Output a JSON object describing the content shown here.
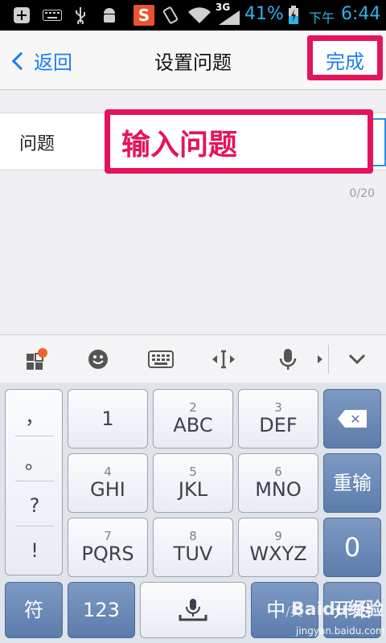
{
  "status_bar": {
    "network": "3G",
    "battery_percent": "41%",
    "time_period": "下午",
    "time": "6:44"
  },
  "nav": {
    "back_label": "返回",
    "title": "设置问题",
    "done_label": "完成"
  },
  "form": {
    "question_label": "问题",
    "input_value": "",
    "overlay_text": "输入问题",
    "counter": "0/20"
  },
  "keyboard": {
    "punctuation": [
      "，",
      "。",
      "?",
      "!"
    ],
    "rows": [
      [
        {
          "num": "",
          "label": "1"
        },
        {
          "num": "2",
          "label": "ABC"
        },
        {
          "num": "3",
          "label": "DEF"
        }
      ],
      [
        {
          "num": "4",
          "label": "GHI"
        },
        {
          "num": "5",
          "label": "JKL"
        },
        {
          "num": "6",
          "label": "MNO"
        }
      ],
      [
        {
          "num": "7",
          "label": "PQRS"
        },
        {
          "num": "8",
          "label": "TUV"
        },
        {
          "num": "9",
          "label": "WXYZ"
        }
      ]
    ],
    "reinput_label": "重输",
    "zero_label": "0",
    "symbol_label": "符",
    "num_label": "123",
    "lang_label": "中",
    "lang_alt_label": "/英",
    "start_label": "开始"
  },
  "watermark": {
    "logo": "Baidu经验",
    "url": "jingyan.baidu.com"
  },
  "colors": {
    "accent_blue": "#1a7ef2",
    "highlight_pink": "#e4145c"
  }
}
